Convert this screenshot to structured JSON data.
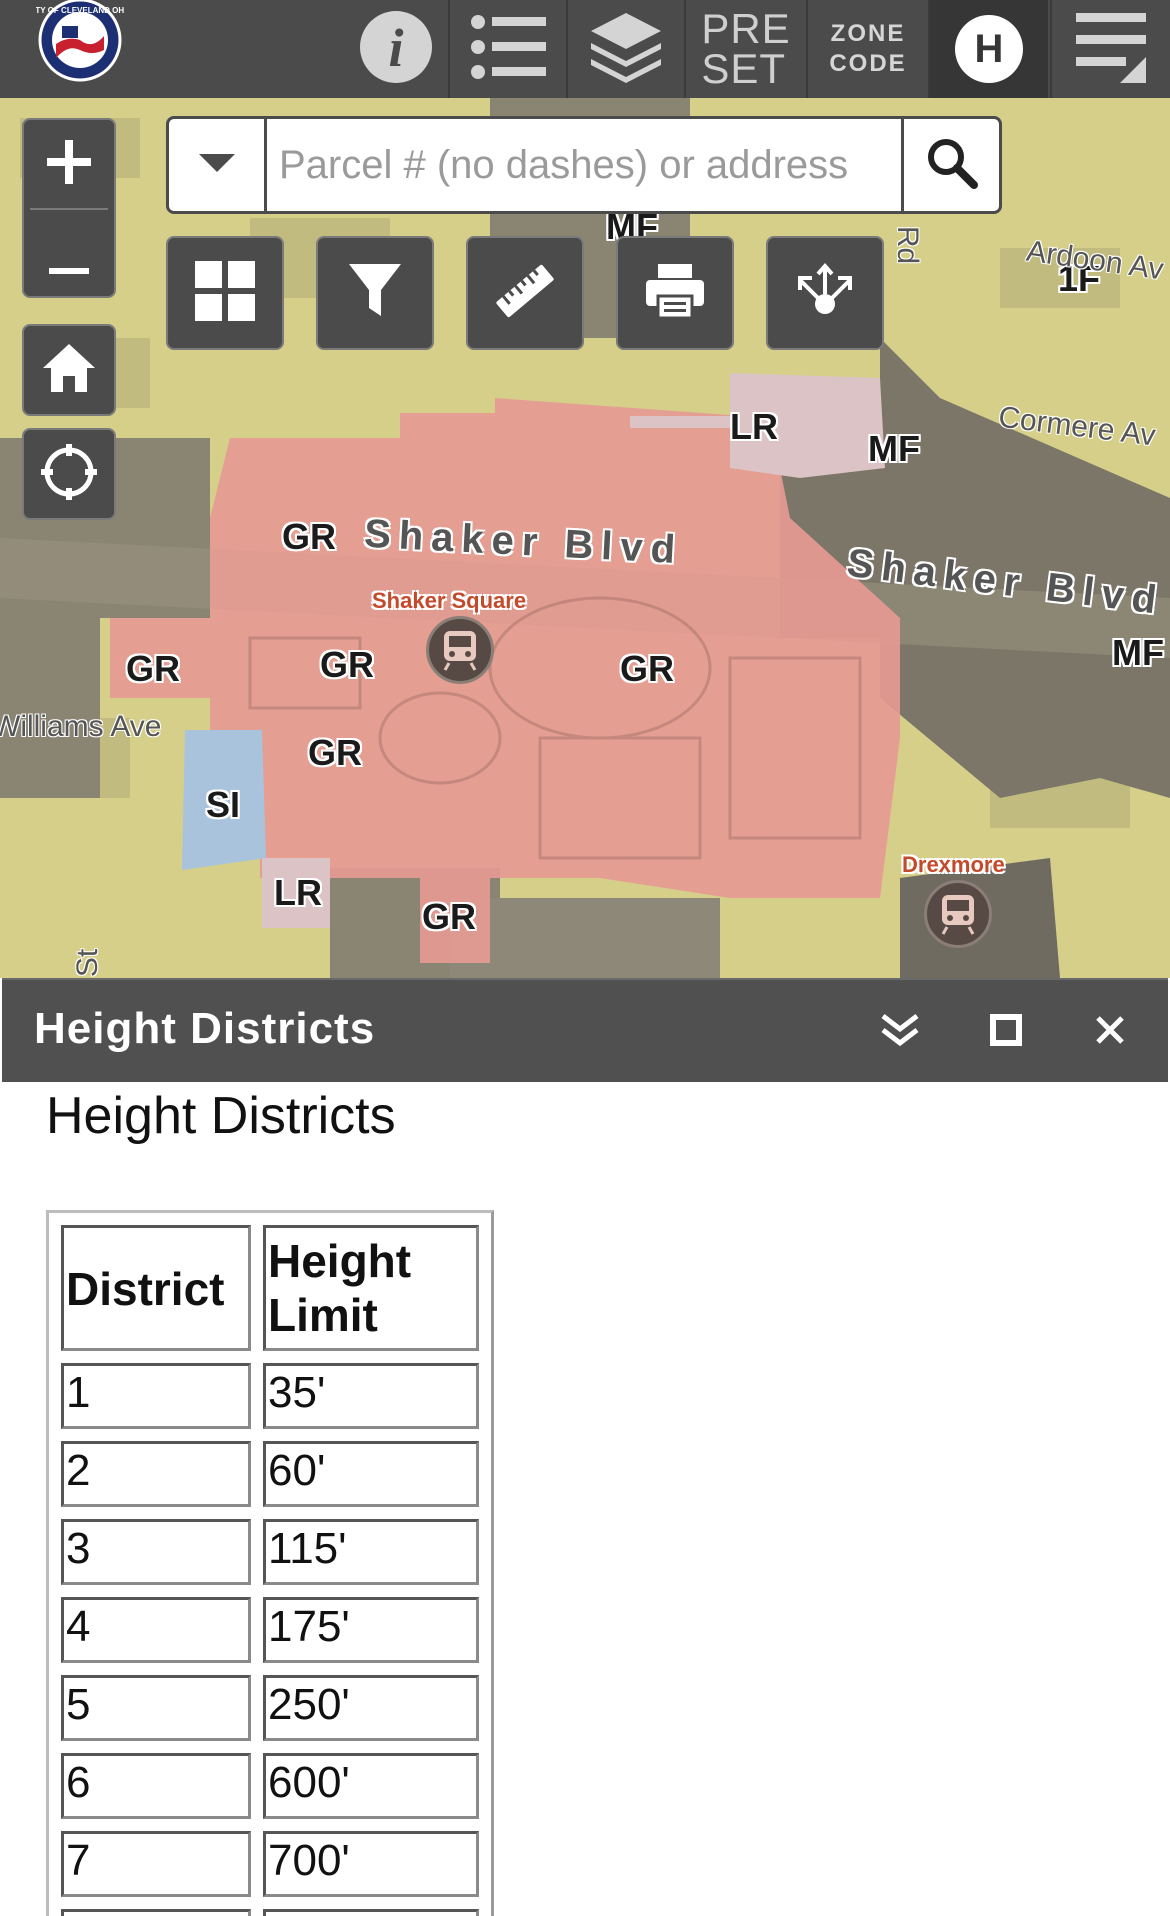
{
  "toolbar": {
    "logo_text": "CITY OF CLEVELAND OHIO",
    "preset_label": "PRE\nSET",
    "zone_code_label": "ZONE\nCODE",
    "height_badge": "H"
  },
  "search": {
    "placeholder": "Parcel # (no dashes) or address"
  },
  "map": {
    "zone_labels": [
      {
        "text": "MF"
      },
      {
        "text": "1F"
      },
      {
        "text": "LR"
      },
      {
        "text": "MF"
      },
      {
        "text": "GR"
      },
      {
        "text": "GR"
      },
      {
        "text": "GR"
      },
      {
        "text": "GR"
      },
      {
        "text": "GR"
      },
      {
        "text": "MF"
      },
      {
        "text": "SI"
      },
      {
        "text": "LR"
      },
      {
        "text": "GR"
      }
    ],
    "streets": {
      "shaker_blvd_west": "Shaker Blvd",
      "shaker_blvd_east": "Shaker Blvd",
      "ardoon": "Ardoon Av",
      "cormere": "Cormere Av",
      "williams": "Williams Ave",
      "rd": "Rd",
      "st": "St"
    },
    "pois": {
      "shaker_square": "Shaker Square",
      "drexmore": "Drexmore"
    },
    "colors": {
      "gr_zone": "#e59a92",
      "mf_zone": "#7b7668",
      "single_family": "#d8d28a",
      "si_zone": "#a9c3dc",
      "lr_zone": "#dcc3c6"
    }
  },
  "panel": {
    "title": "Height Districts",
    "content_heading": "Height Districts"
  },
  "table": {
    "headers": [
      "District",
      "Height Limit"
    ],
    "rows": [
      [
        "1",
        "35'"
      ],
      [
        "2",
        "60'"
      ],
      [
        "3",
        "115'"
      ],
      [
        "4",
        "175'"
      ],
      [
        "5",
        "250'"
      ],
      [
        "6",
        "600'"
      ],
      [
        "7",
        "700'"
      ]
    ]
  }
}
